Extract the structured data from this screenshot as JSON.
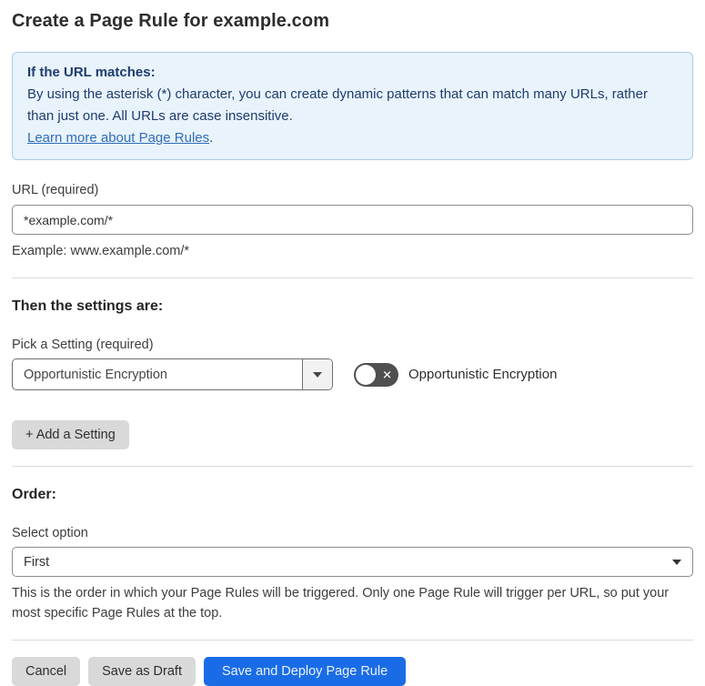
{
  "page": {
    "title": "Create a Page Rule for example.com"
  },
  "info_box": {
    "heading": "If the URL matches:",
    "body": "By using the asterisk (*) character, you can create dynamic patterns that can match many URLs, rather than just one. All URLs are case insensitive.",
    "link_label": "Learn more about Page Rules",
    "link_suffix": "."
  },
  "url_section": {
    "label": "URL (required)",
    "value": "*example.com/*",
    "helper": "Example: www.example.com/*"
  },
  "settings_section": {
    "heading": "Then the settings are:",
    "setting_label": "Pick a Setting (required)",
    "setting_value": "Opportunistic Encryption",
    "toggle_state": "off",
    "toggle_icon": "✕",
    "toggle_label": "Opportunistic Encryption",
    "add_setting_label": "+ Add a Setting"
  },
  "order_section": {
    "heading": "Order:",
    "select_label": "Select option",
    "select_value": "First",
    "helper": "This is the order in which your Page Rules will be triggered. Only one Page Rule will trigger per URL, so put your most specific Page Rules at the top."
  },
  "footer": {
    "cancel_label": "Cancel",
    "save_draft_label": "Save as Draft",
    "save_deploy_label": "Save and Deploy Page Rule"
  },
  "colors": {
    "info_bg": "#e9f3fc",
    "info_border": "#abc9e9",
    "info_text": "#1e3c6e",
    "link_blue": "#2f6db8",
    "primary_blue": "#1a6ce6",
    "button_gray": "#d9d9d9",
    "toggle_off_bg": "#4f4f4f"
  }
}
